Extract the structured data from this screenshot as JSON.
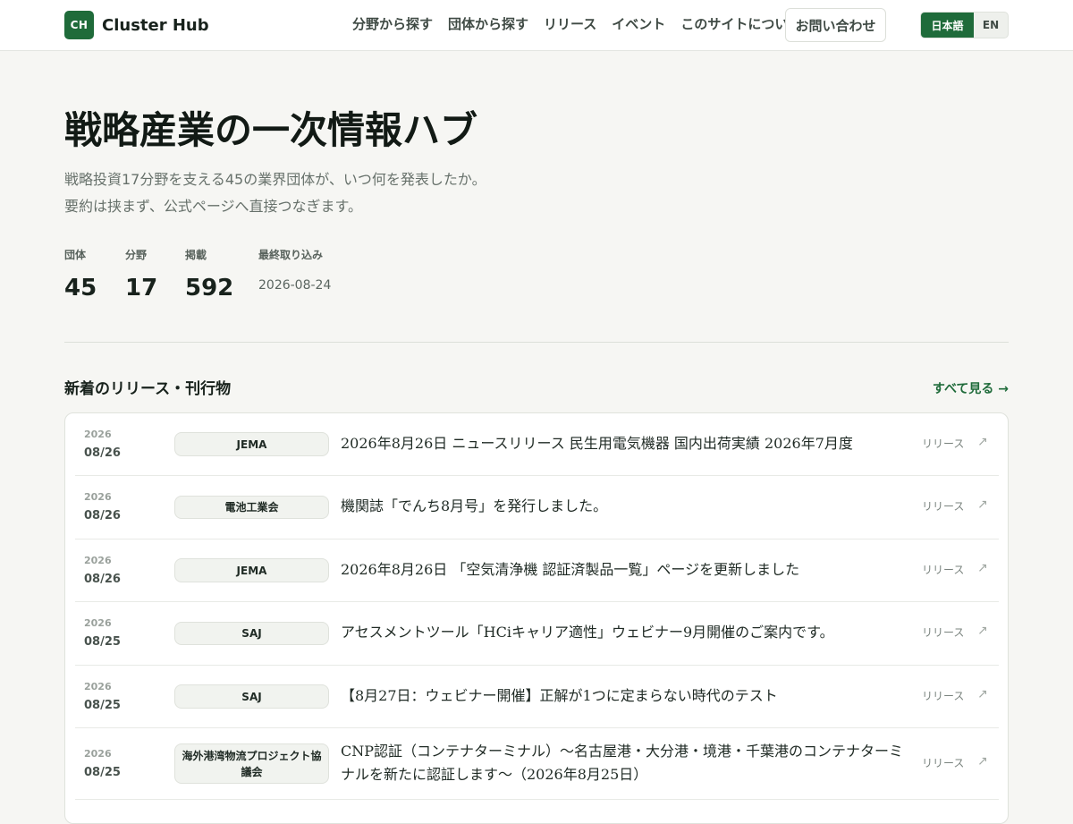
{
  "header": {
    "logo_mark": "CH",
    "app_name": "Cluster Hub",
    "nav": [
      "分野から探す",
      "団体から探す",
      "リリース",
      "イベント",
      "このサイトについて"
    ],
    "contact_label": "お問い合わせ",
    "lang": {
      "active": "日本語",
      "inactive": "EN"
    }
  },
  "hero": {
    "title": "戦略産業の一次情報ハブ",
    "subtitle_line1": "戦略投資17分野を支える45の業界団体が、いつ何を発表したか。",
    "subtitle_line2": "要約は挟まず、公式ページへ直接つなぎます。",
    "stats": [
      {
        "label": "団体",
        "value": "45"
      },
      {
        "label": "分野",
        "value": "17"
      },
      {
        "label": "掲載",
        "value": "592"
      },
      {
        "label": "最終取り込み",
        "value": "2026-08-24"
      }
    ]
  },
  "releases": {
    "section_title": "新着のリリース・刊行物",
    "see_all_label": "すべて見る →",
    "items": [
      {
        "year": "2026",
        "date": "08/26",
        "org": "JEMA",
        "title": "2026年8月26日 ニュースリリース 民生用電気機器 国内出荷実績 2026年7月度",
        "type": "リリース",
        "link_icon": "↗"
      },
      {
        "year": "2026",
        "date": "08/26",
        "org": "電池工業会",
        "title": "機関誌「でんち8月号」を発行しました。",
        "type": "リリース",
        "link_icon": "↗"
      },
      {
        "year": "2026",
        "date": "08/26",
        "org": "JEMA",
        "title": "2026年8月26日 「空気清浄機 認証済製品一覧」ページを更新しました",
        "type": "リリース",
        "link_icon": "↗"
      },
      {
        "year": "2026",
        "date": "08/25",
        "org": "SAJ",
        "title": "アセスメントツール「HCiキャリア適性」ウェビナー9月開催のご案内です。",
        "type": "リリース",
        "link_icon": "↗"
      },
      {
        "year": "2026",
        "date": "08/25",
        "org": "SAJ",
        "title": "【8月27日：ウェビナー開催】正解が1つに定まらない時代のテスト",
        "type": "リリース",
        "link_icon": "↗"
      },
      {
        "year": "2026",
        "date": "08/25",
        "org": "海外港湾物流プロジェクト協議会",
        "title": "CNP認証（コンテナターミナル）～名古屋港・大分港・境港・千葉港のコンテナターミナルを新たに認証します～（2026年8月25日）",
        "type": "リリース",
        "link_icon": "↗"
      }
    ]
  }
}
